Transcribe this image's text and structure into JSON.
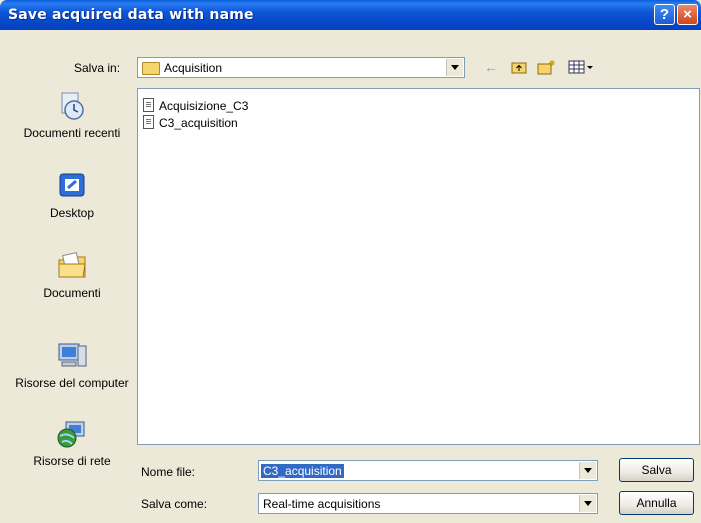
{
  "window": {
    "title": "Save acquired data with name",
    "help": "?",
    "close": "×"
  },
  "toolbar": {
    "save_in_label": "Salva in:",
    "folder": "Acquisition",
    "back_glyph": "←"
  },
  "places": [
    {
      "label": "Documenti recenti",
      "icon": "recent-documents-icon"
    },
    {
      "label": "Desktop",
      "icon": "desktop-icon"
    },
    {
      "label": "Documenti",
      "icon": "documents-icon"
    },
    {
      "label": "Risorse del computer",
      "icon": "my-computer-icon"
    },
    {
      "label": "Risorse di rete",
      "icon": "network-icon"
    }
  ],
  "files": [
    "Acquisizione_C3",
    "C3_acquisition"
  ],
  "form": {
    "filename_label": "Nome file:",
    "filename_value": "C3_acquisition",
    "savetype_label": "Salva come:",
    "savetype_value": "Real-time acquisitions",
    "save_button": "Salva",
    "cancel_button": "Annulla"
  }
}
